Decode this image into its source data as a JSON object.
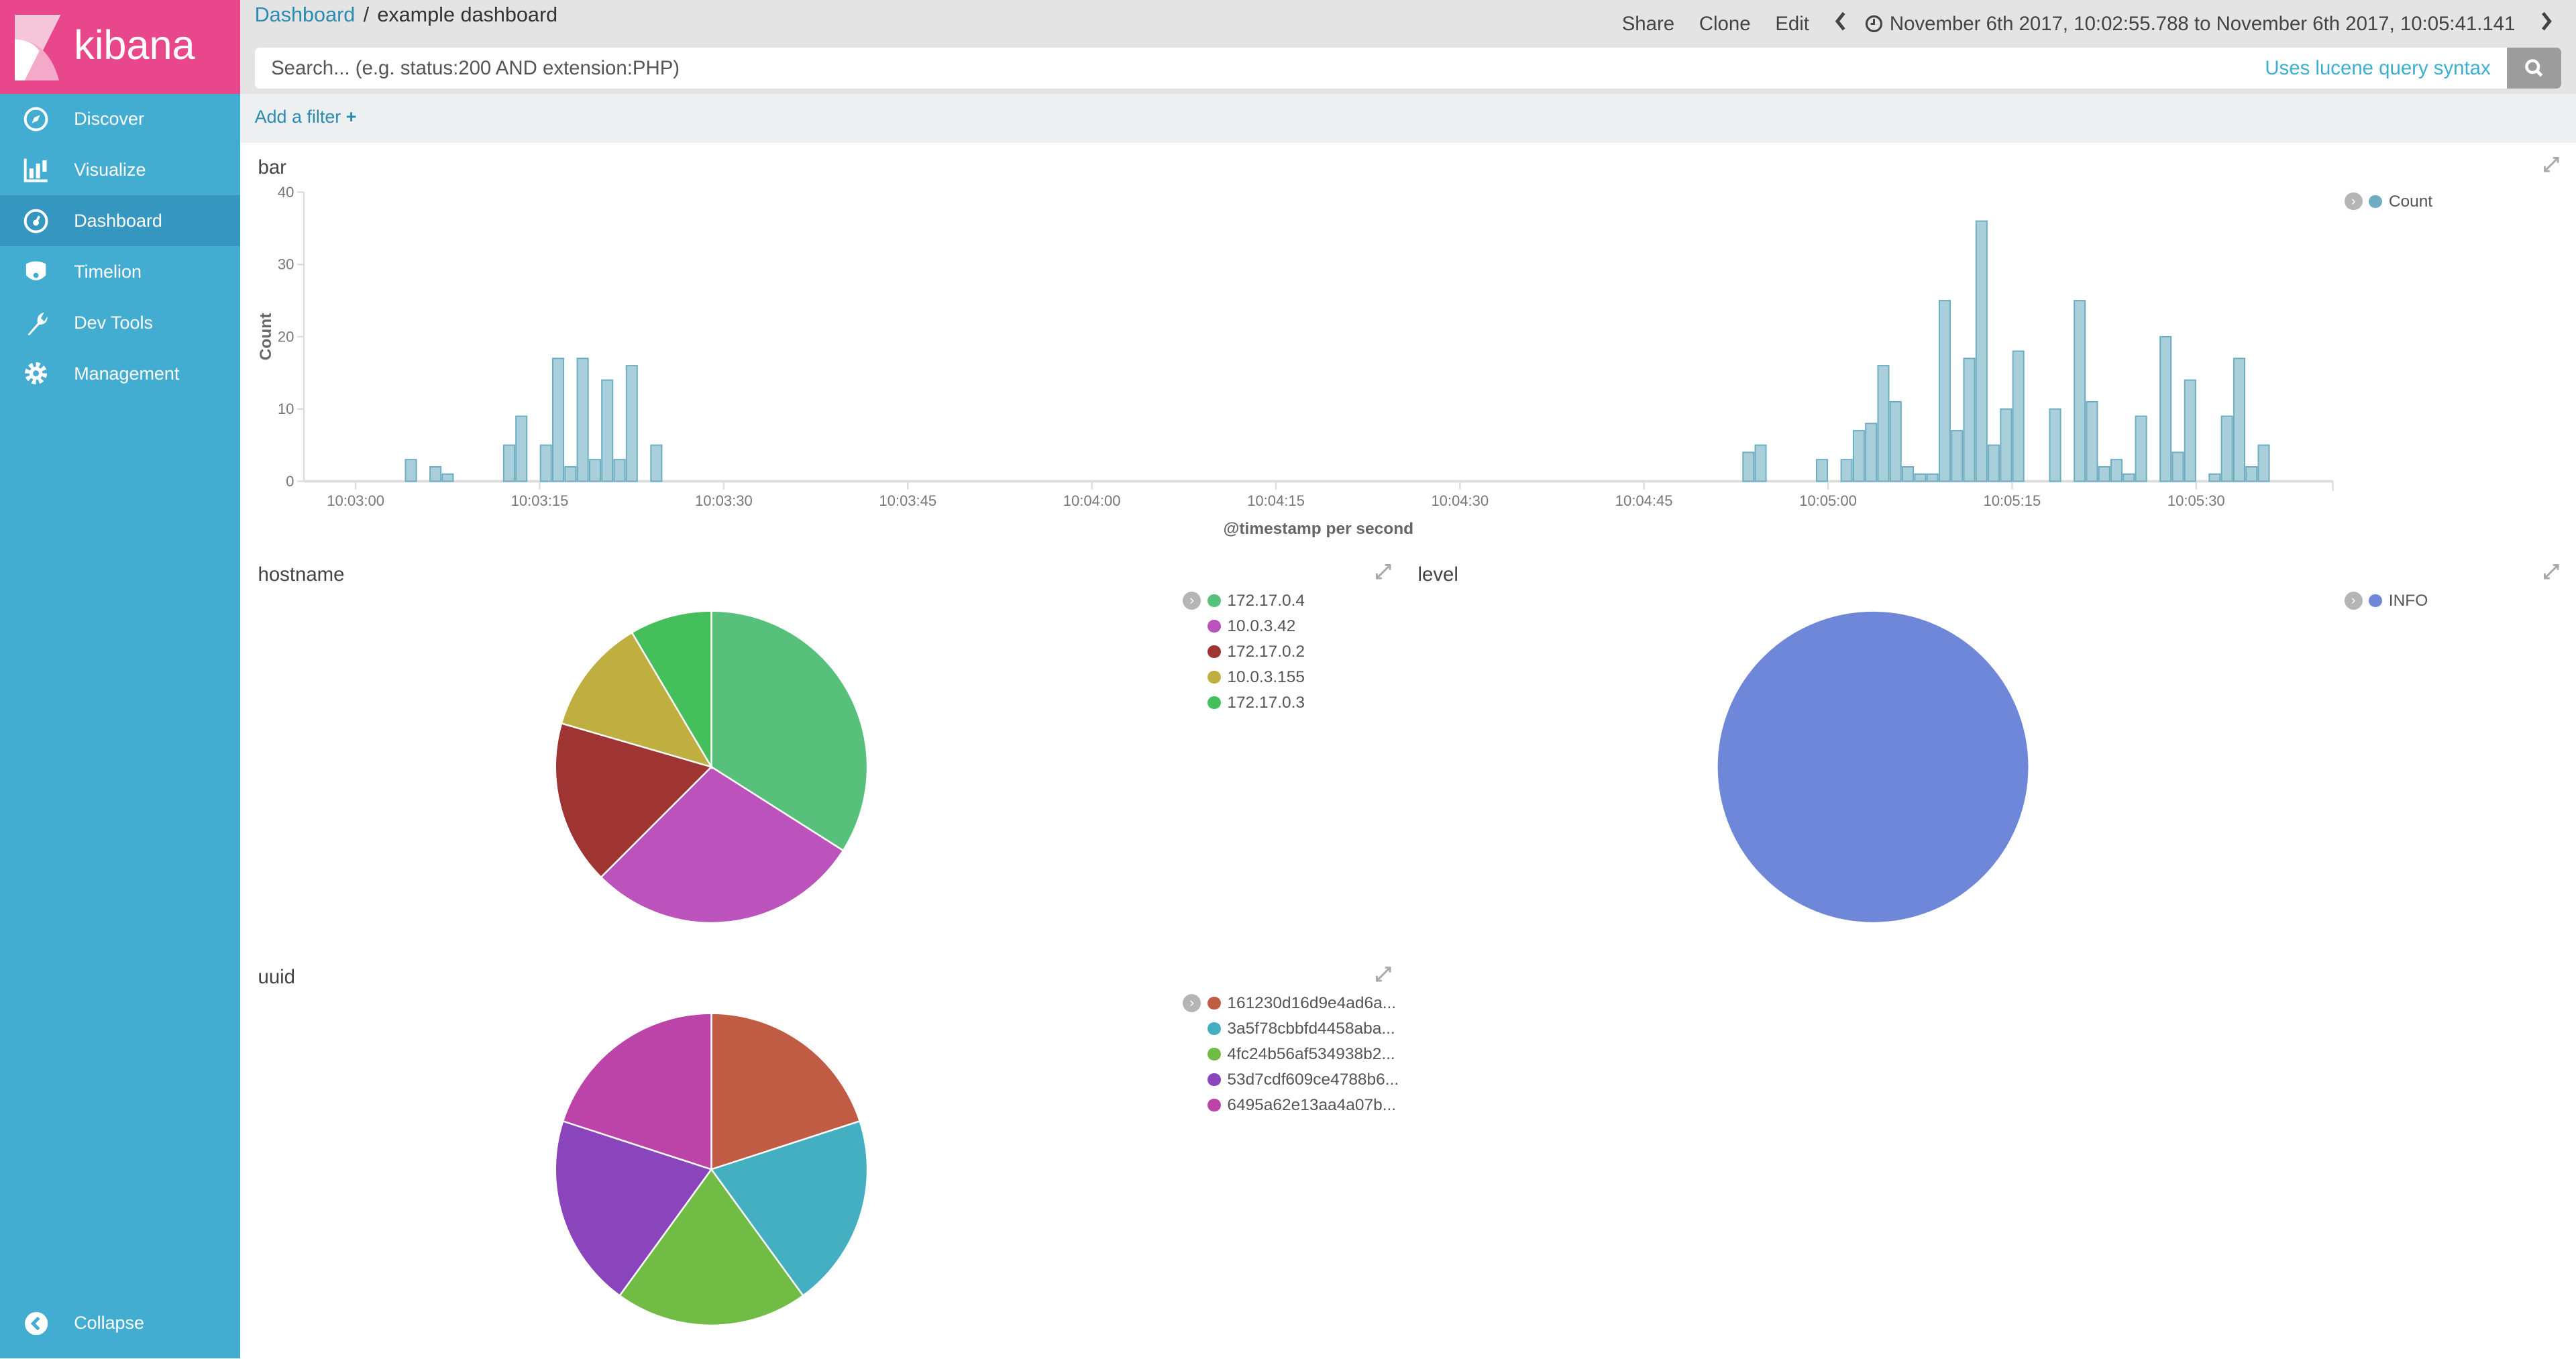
{
  "app": {
    "logo_text": "kibana"
  },
  "sidebar": {
    "items": [
      {
        "label": "Discover",
        "icon": "compass-icon"
      },
      {
        "label": "Visualize",
        "icon": "bar-chart-icon"
      },
      {
        "label": "Dashboard",
        "icon": "dashboard-icon",
        "active": true
      },
      {
        "label": "Timelion",
        "icon": "timelion-icon"
      },
      {
        "label": "Dev Tools",
        "icon": "wrench-icon"
      },
      {
        "label": "Management",
        "icon": "gear-icon"
      }
    ],
    "collapse_label": "Collapse"
  },
  "header": {
    "breadcrumb": {
      "root": "Dashboard",
      "separator": "/",
      "current": "example dashboard"
    },
    "menu": {
      "share": "Share",
      "clone": "Clone",
      "edit": "Edit"
    },
    "time_range": "November 6th 2017, 10:02:55.788 to November 6th 2017, 10:05:41.141"
  },
  "search": {
    "placeholder": "Search... (e.g. status:200 AND extension:PHP)",
    "value": "",
    "syntax_link": "Uses lucene query syntax"
  },
  "filter": {
    "add_label": "Add a filter"
  },
  "panels": {
    "bar": {
      "title": "bar"
    },
    "hostname": {
      "title": "hostname"
    },
    "level": {
      "title": "level"
    },
    "uuid": {
      "title": "uuid"
    }
  },
  "chart_data": [
    {
      "type": "bar",
      "title": "bar",
      "xlabel": "@timestamp per second",
      "ylabel": "Count",
      "ylim": [
        0,
        40
      ],
      "xlim": [
        "10:02:55.788",
        "10:05:41.141"
      ],
      "yticks": [
        "0",
        "10",
        "20",
        "30",
        "40"
      ],
      "xticks": [
        "10:03:00",
        "10:03:15",
        "10:03:30",
        "10:03:45",
        "10:04:00",
        "10:04:15",
        "10:04:30",
        "10:04:45",
        "10:05:00",
        "10:05:15",
        "10:05:30"
      ],
      "legend": {
        "position": "top-right",
        "entries": [
          "Count"
        ]
      },
      "color": "#a9cfda",
      "series": [
        {
          "name": "Count",
          "points": [
            [
              "10:03:04",
              3
            ],
            [
              "10:03:06",
              2
            ],
            [
              "10:03:07",
              1
            ],
            [
              "10:03:12",
              5
            ],
            [
              "10:03:13",
              9
            ],
            [
              "10:03:15",
              5
            ],
            [
              "10:03:16",
              17
            ],
            [
              "10:03:17",
              2
            ],
            [
              "10:03:18",
              17
            ],
            [
              "10:03:19",
              3
            ],
            [
              "10:03:20",
              14
            ],
            [
              "10:03:21",
              3
            ],
            [
              "10:03:22",
              16
            ],
            [
              "10:03:24",
              5
            ],
            [
              "10:04:53",
              4
            ],
            [
              "10:04:54",
              5
            ],
            [
              "10:04:59",
              3
            ],
            [
              "10:05:01",
              3
            ],
            [
              "10:05:02",
              7
            ],
            [
              "10:05:03",
              8
            ],
            [
              "10:05:04",
              16
            ],
            [
              "10:05:05",
              11
            ],
            [
              "10:05:06",
              2
            ],
            [
              "10:05:07",
              1
            ],
            [
              "10:05:08",
              1
            ],
            [
              "10:05:09",
              25
            ],
            [
              "10:05:10",
              7
            ],
            [
              "10:05:11",
              17
            ],
            [
              "10:05:12",
              36
            ],
            [
              "10:05:13",
              5
            ],
            [
              "10:05:14",
              10
            ],
            [
              "10:05:15",
              18
            ],
            [
              "10:05:18",
              10
            ],
            [
              "10:05:20",
              25
            ],
            [
              "10:05:21",
              11
            ],
            [
              "10:05:22",
              2
            ],
            [
              "10:05:23",
              3
            ],
            [
              "10:05:24",
              1
            ],
            [
              "10:05:25",
              9
            ],
            [
              "10:05:27",
              20
            ],
            [
              "10:05:28",
              4
            ],
            [
              "10:05:29",
              14
            ],
            [
              "10:05:31",
              1
            ],
            [
              "10:05:32",
              9
            ],
            [
              "10:05:33",
              17
            ],
            [
              "10:05:34",
              2
            ],
            [
              "10:05:35",
              5
            ]
          ]
        }
      ]
    },
    {
      "type": "pie",
      "title": "hostname",
      "legend": {
        "position": "right"
      },
      "slices": [
        {
          "label": "172.17.0.4",
          "value": 34,
          "color": "#57c17b"
        },
        {
          "label": "10.0.3.42",
          "value": 28.5,
          "color": "#bc52bc"
        },
        {
          "label": "172.17.0.2",
          "value": 17,
          "color": "#9e3533"
        },
        {
          "label": "10.0.3.155",
          "value": 12,
          "color": "#bfaf40"
        },
        {
          "label": "172.17.0.3",
          "value": 8.5,
          "color": "#45bf5c"
        }
      ]
    },
    {
      "type": "pie",
      "title": "level",
      "legend": {
        "position": "right"
      },
      "slices": [
        {
          "label": "INFO",
          "value": 100,
          "color": "#6f87d8"
        }
      ]
    },
    {
      "type": "pie",
      "title": "uuid",
      "legend": {
        "position": "right"
      },
      "slices": [
        {
          "label": "161230d16d9e4ad6a...",
          "value": 20,
          "color": "#c15c44"
        },
        {
          "label": "3a5f78cbbfd4458aba...",
          "value": 20,
          "color": "#44afc0"
        },
        {
          "label": "4fc24b56af534938b2...",
          "value": 20,
          "color": "#70bc44"
        },
        {
          "label": "53d7cdf609ce4788b6...",
          "value": 20,
          "color": "#8a44bc"
        },
        {
          "label": "6495a62e13aa4a07b...",
          "value": 20,
          "color": "#bc44a8"
        }
      ]
    }
  ]
}
